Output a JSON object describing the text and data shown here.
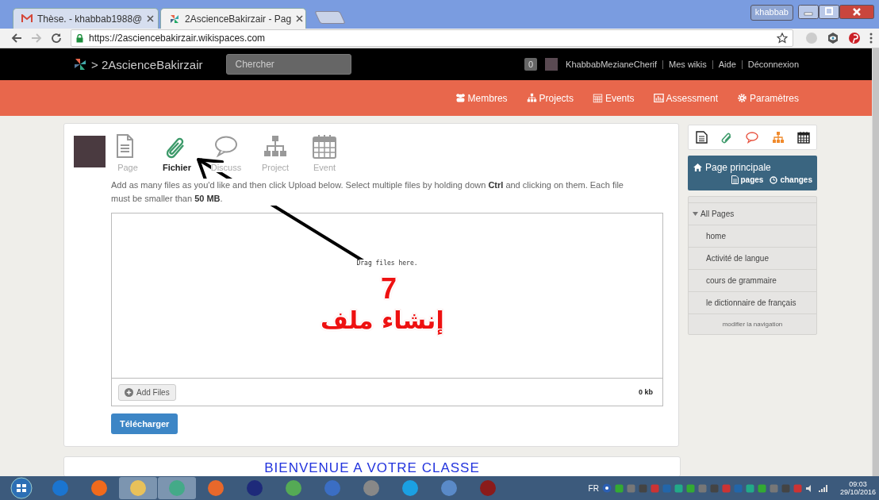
{
  "browser": {
    "tabs": [
      {
        "title": "Thèse. - khabbab1988@",
        "selected": false
      },
      {
        "title": "2AscienceBakirzair - Pag",
        "selected": true
      }
    ],
    "profile": "khabbab",
    "url": "https://2asciencebakirzair.wikispaces.com"
  },
  "site_header": {
    "site_name": "> 2AscienceBakirzair",
    "search": {
      "placeholder": "Chercher"
    },
    "notification_count": "0",
    "user_links": [
      "KhabbabMezianeCherif",
      "Mes wikis",
      "Aide",
      "Déconnexion"
    ]
  },
  "nav": [
    "Membres",
    "Projects",
    "Events",
    "Assessment",
    "Paramètres"
  ],
  "create_tabs": [
    {
      "label": "Page",
      "selected": false
    },
    {
      "label": "Fichier",
      "selected": true
    },
    {
      "label": "Discuss",
      "selected": false
    },
    {
      "label": "Project",
      "selected": false
    },
    {
      "label": "Event",
      "selected": false
    }
  ],
  "upload": {
    "instructions": "Add as many files as you'd like and then click Upload below. Select multiple files by holding down **Ctrl** and clicking on them. Each file must be smaller than **50 MB**.",
    "drop_hint": "Drag files here.",
    "add_button": "Add Files",
    "total_size": "0 kb",
    "submit_button": "Télécharger"
  },
  "sidebar": {
    "home_link": "Page principale",
    "pages_link": "pages",
    "changes_link": "changes",
    "tree": {
      "label": "All Pages",
      "expanded": true,
      "children": [
        {
          "label": "home"
        },
        {
          "label": "Activité de langue"
        },
        {
          "label": "cours de grammaire"
        },
        {
          "label": "le dictionnaire de français"
        }
      ]
    },
    "edit_link": "modifier la navigation"
  },
  "welcome_heading": "BIENVENUE A VOTRE CLASSE",
  "annotation": {
    "number": "7",
    "caption": "إنشاء ملف"
  },
  "taskbar": {
    "language": "FR",
    "time": "09:03",
    "date": "29/10/2016"
  }
}
